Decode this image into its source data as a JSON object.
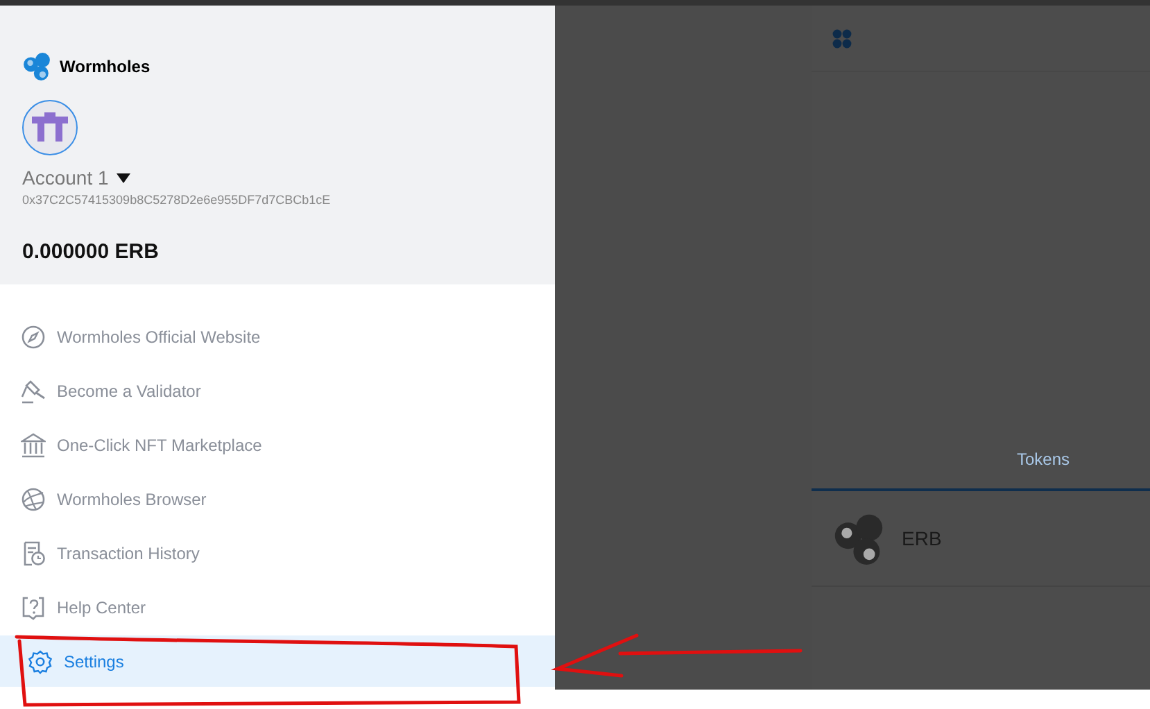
{
  "drawer": {
    "brand": "Wormholes",
    "account": {
      "name": "Account 1",
      "address": "0x37C2C57415309b8C5278D2e6e955DF7d7CBCb1cE"
    },
    "balance": "0.000000 ERB",
    "menu": [
      {
        "kind": "compass",
        "label": "Wormholes Official Website",
        "selected": false
      },
      {
        "kind": "gavel",
        "label": "Become a Validator",
        "selected": false
      },
      {
        "kind": "bank",
        "label": "One-Click NFT Marketplace",
        "selected": false
      },
      {
        "kind": "globe",
        "label": "Wormholes Browser",
        "selected": false
      },
      {
        "kind": "history",
        "label": "Transaction History",
        "selected": false
      },
      {
        "kind": "help",
        "label": "Help Center",
        "selected": false
      },
      {
        "kind": "gear",
        "label": "Settings",
        "selected": true
      }
    ]
  },
  "main": {
    "tabs": [
      {
        "label": "Tokens",
        "selected": true
      }
    ],
    "tokens": [
      {
        "symbol": "ERB"
      }
    ]
  }
}
